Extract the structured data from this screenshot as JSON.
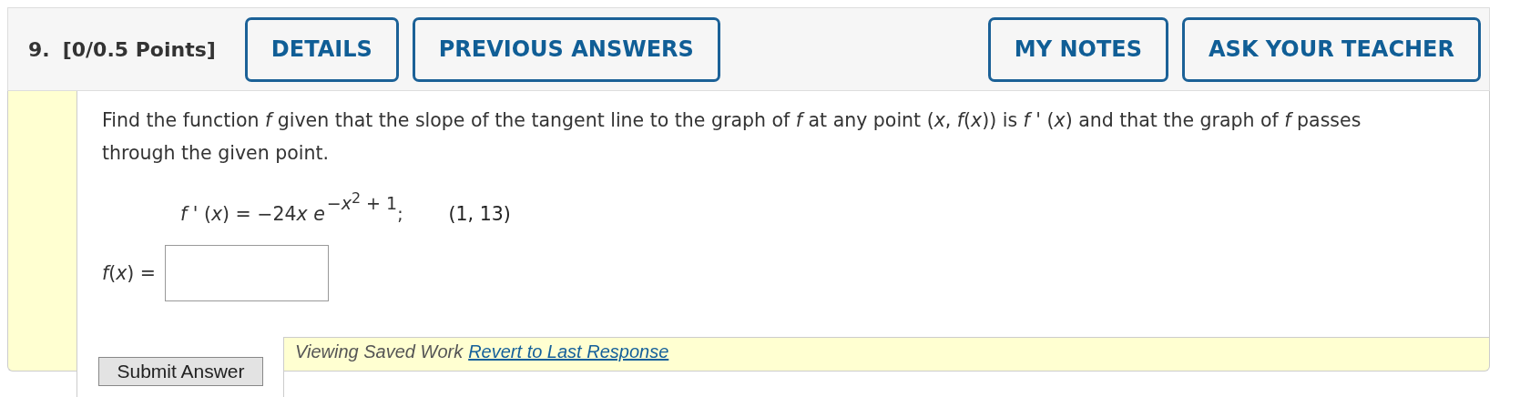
{
  "header": {
    "number": "9.",
    "points": "[0/0.5 Points]",
    "buttons_left": [
      {
        "label": "DETAILS"
      },
      {
        "label": "PREVIOUS ANSWERS"
      }
    ],
    "buttons_right": [
      {
        "label": "MY NOTES"
      },
      {
        "label": "ASK YOUR TEACHER"
      }
    ]
  },
  "question": {
    "text": "Find the function *f* given that the slope of the tangent line to the graph of *f* at any point (*x*, *f*(*x*)) is *f* ' (*x*) and that the graph of *f* passes through the given point.",
    "formula": {
      "lhs": "*f* ' (*x*) = −24",
      "base": "*x* *e*",
      "exponent": "−*x*$^{2}$ + 1",
      "end": ";"
    },
    "point": "(1, 13)"
  },
  "answer": {
    "label": "*f*(*x*) ="
  },
  "submit": {
    "label": "Submit Answer"
  },
  "saved": {
    "text": "Viewing Saved Work",
    "link": "Revert to Last Response"
  }
}
